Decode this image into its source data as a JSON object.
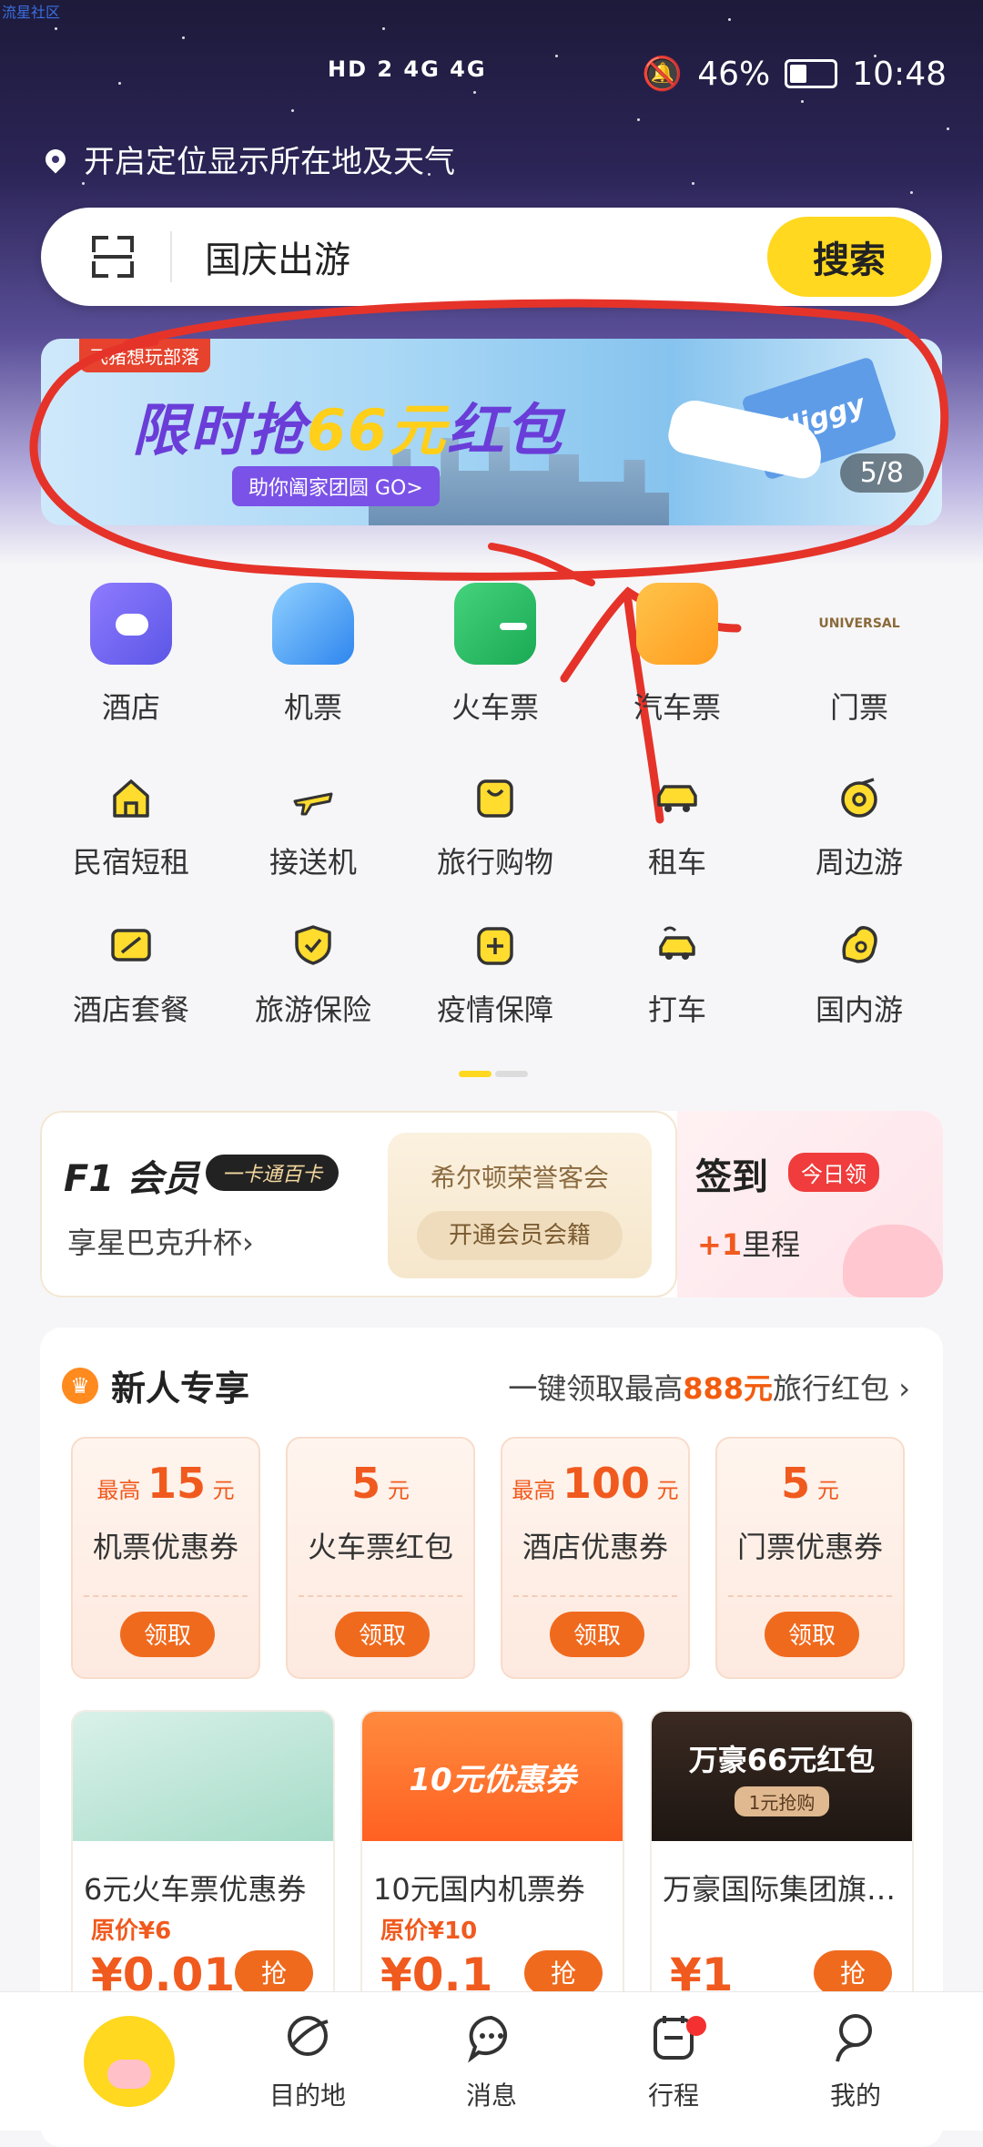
{
  "watermark": "流星社区",
  "status_bar": {
    "signal_text": "HD 2  4G  4G",
    "battery": "46%",
    "time": "10:48"
  },
  "location": {
    "text": "开启定位显示所在地及天气"
  },
  "search": {
    "query": "国庆出游",
    "button": "搜索"
  },
  "banner": {
    "tag": "飞猪想玩部落",
    "title_prefix": "限时抢",
    "title_highlight": "66元",
    "title_suffix": "红包",
    "cta": "助你阖家团圆 GO>",
    "ticket_text": "Fliggy",
    "counter": "5/8"
  },
  "primary_categories": [
    {
      "label": "酒店",
      "icon": "hotel-icon"
    },
    {
      "label": "机票",
      "icon": "flight-icon"
    },
    {
      "label": "火车票",
      "icon": "train-icon"
    },
    {
      "label": "汽车票",
      "icon": "bus-icon"
    },
    {
      "label": "门票",
      "icon": "ticket-icon"
    }
  ],
  "secondary_row1": [
    {
      "label": "民宿短租",
      "icon": "homestay-icon"
    },
    {
      "label": "接送机",
      "icon": "plane-transfer-icon"
    },
    {
      "label": "旅行购物",
      "icon": "shopping-bag-icon"
    },
    {
      "label": "租车",
      "icon": "car-rental-icon"
    },
    {
      "label": "周边游",
      "icon": "nearby-tour-icon"
    }
  ],
  "secondary_row2": [
    {
      "label": "酒店套餐",
      "icon": "hotel-package-icon"
    },
    {
      "label": "旅游保险",
      "icon": "insurance-shield-icon"
    },
    {
      "label": "疫情保障",
      "icon": "plus-shield-icon"
    },
    {
      "label": "打车",
      "icon": "taxi-icon"
    },
    {
      "label": "国内游",
      "icon": "domestic-tour-icon"
    }
  ],
  "member": {
    "title": "F1 会员",
    "badge": "一卡通百卡",
    "subtitle": "享星巴克升杯",
    "hilton_title": "希尔顿荣誉客会",
    "hilton_button": "开通会员会籍",
    "checkin": "签到",
    "checkin_badge": "今日领",
    "mileage_plus": "+1",
    "mileage_text": "里程"
  },
  "newcomer": {
    "title": "新人专享",
    "promo_prefix": "一键领取最高",
    "promo_amount": "888元",
    "promo_suffix": "旅行红包",
    "coupons": [
      {
        "prefix": "最高",
        "amount": "15",
        "unit": "元",
        "name": "机票优惠券",
        "button": "领取"
      },
      {
        "prefix": "",
        "amount": "5",
        "unit": "元",
        "name": "火车票红包",
        "button": "领取"
      },
      {
        "prefix": "最高",
        "amount": "100",
        "unit": "元",
        "name": "酒店优惠券",
        "button": "领取"
      },
      {
        "prefix": "",
        "amount": "5",
        "unit": "元",
        "name": "门票优惠券",
        "button": "领取"
      }
    ],
    "products": [
      {
        "name": "6元火车票优惠券",
        "original": "原价¥6",
        "price": "¥0.01",
        "button": "抢"
      },
      {
        "name": "10元国内机票券",
        "original": "原价¥10",
        "price": "¥0.1",
        "button": "抢",
        "image_text": "10元优惠券"
      },
      {
        "name": "万豪国际集团旗舰店",
        "original": "",
        "price": "¥1",
        "button": "抢",
        "image_text": "万豪66元红包",
        "image_sub": "1元抢购"
      }
    ]
  },
  "bottom_nav": [
    {
      "label": "",
      "icon": "home-logo-icon"
    },
    {
      "label": "目的地",
      "icon": "destination-icon"
    },
    {
      "label": "消息",
      "icon": "message-icon"
    },
    {
      "label": "行程",
      "icon": "itinerary-icon"
    },
    {
      "label": "我的",
      "icon": "profile-icon"
    }
  ],
  "colors": {
    "accent": "#ffd81f",
    "orange": "#f06a1e",
    "annotation": "#e5332a"
  }
}
